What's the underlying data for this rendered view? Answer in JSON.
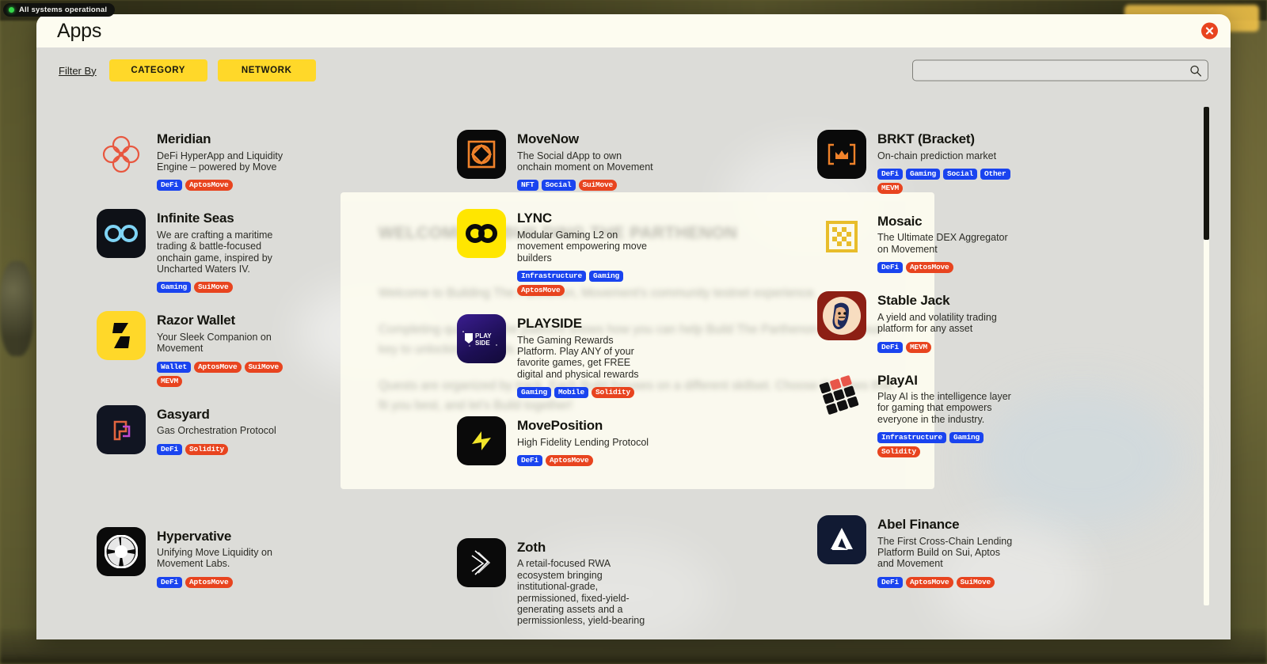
{
  "status": {
    "text": "All systems operational",
    "dot_color": "#35d64a"
  },
  "modal": {
    "title": "Apps",
    "close_label": "close-button"
  },
  "filter": {
    "label": "Filter By",
    "buttons": [
      "CATEGORY",
      "NETWORK"
    ]
  },
  "search": {
    "value": "",
    "placeholder": ""
  },
  "welcome": {
    "heading": "WELCOME TO BUILDING THE PARTHENON",
    "paragraphs": [
      "Welcome to Building The Parthenon, Movement's community testnet experience.",
      "Completing quests on the platform shows how you can help Build The Parthenon and is your key to unlocking rewards.",
      "Quests are organized by track. Each Build focuses on a different skillset. Choose the ones that fit you best, and let's Build together!"
    ]
  },
  "colors": {
    "accent_yellow": "#ffd829",
    "tag_category": "#1a44ef",
    "tag_network": "#e8441f",
    "close_red": "#e8441f",
    "header_cream": "#fdfcf0",
    "body_grey": "#dcdcd8"
  },
  "scrollbar": {
    "thumb_percent": 27
  },
  "columns": [
    {
      "apps": [
        {
          "name": "Meridian",
          "desc": "DeFi HyperApp and Liquidity Engine – powered by Move",
          "icon": "meridian-logo",
          "categories": [
            "DeFi"
          ],
          "networks": [
            "AptosMove"
          ]
        },
        {
          "name": "Infinite Seas",
          "desc": "We are crafting a maritime trading & battle-focused onchain game, inspired by Uncharted Waters IV.",
          "icon": "infinite-seas-logo",
          "categories": [
            "Gaming"
          ],
          "networks": [
            "SuiMove"
          ]
        },
        {
          "name": "Razor Wallet",
          "desc": "Your Sleek Companion on Movement",
          "icon": "razor-wallet-logo",
          "categories": [
            "Wallet"
          ],
          "networks": [
            "AptosMove",
            "SuiMove",
            "MEVM"
          ]
        },
        {
          "name": "Gasyard",
          "desc": "Gas Orchestration Protocol",
          "icon": "gasyard-logo",
          "categories": [
            "DeFi"
          ],
          "networks": [
            "Solidity"
          ]
        },
        {
          "name": "Hypervative",
          "desc": "Unifying Move Liquidity on Movement Labs.",
          "icon": "hypervative-logo",
          "categories": [
            "DeFi"
          ],
          "networks": [
            "AptosMove"
          ]
        }
      ]
    },
    {
      "apps": [
        {
          "name": "MoveNow",
          "desc": "The Social dApp to own onchain moment on Movement",
          "icon": "movenow-logo",
          "categories": [
            "NFT",
            "Social"
          ],
          "networks": [
            "SuiMove"
          ]
        },
        {
          "name": "LYNC",
          "desc": "Modular Gaming L2 on movement empowering move builders",
          "icon": "lync-logo",
          "categories": [
            "Infrastructure",
            "Gaming"
          ],
          "networks": [
            "AptosMove"
          ]
        },
        {
          "name": "PLAYSIDE",
          "desc": "The Gaming Rewards Platform. Play ANY of your favorite games, get FREE digital and physical rewards",
          "icon": "playside-logo",
          "categories": [
            "Gaming",
            "Mobile"
          ],
          "networks": [
            "Solidity"
          ]
        },
        {
          "name": "MovePosition",
          "desc": "High Fidelity Lending Protocol",
          "icon": "moveposition-logo",
          "categories": [
            "DeFi"
          ],
          "networks": [
            "AptosMove"
          ]
        },
        {
          "name": "Zoth",
          "desc": "A retail-focused RWA ecosystem bringing institutional-grade, permissioned, fixed-yield-generating assets and a permissionless, yield-bearing",
          "icon": "zoth-logo",
          "categories": [],
          "networks": []
        }
      ]
    },
    {
      "apps": [
        {
          "name": "BRKT (Bracket)",
          "desc": "On-chain prediction market",
          "icon": "brkt-logo",
          "categories": [
            "DeFi",
            "Gaming",
            "Social",
            "Other"
          ],
          "networks": [
            "MEVM"
          ]
        },
        {
          "name": "Mosaic",
          "desc": "The Ultimate DEX Aggregator on Movement",
          "icon": "mosaic-logo",
          "categories": [
            "DeFi"
          ],
          "networks": [
            "AptosMove"
          ]
        },
        {
          "name": "Stable Jack",
          "desc": "A yield and volatility trading platform for any asset",
          "icon": "stable-jack-logo",
          "categories": [
            "DeFi"
          ],
          "networks": [
            "MEVM"
          ]
        },
        {
          "name": "PlayAI",
          "desc": "Play AI is the intelligence layer for gaming that empowers everyone in the industry.",
          "icon": "playai-logo",
          "categories": [
            "Infrastructure",
            "Gaming"
          ],
          "networks": [
            "Solidity"
          ]
        },
        {
          "name": "Abel Finance",
          "desc": "The First Cross-Chain Lending Platform Build on Sui, Aptos and Movement",
          "icon": "abel-finance-logo",
          "categories": [
            "DeFi"
          ],
          "networks": [
            "AptosMove",
            "SuiMove"
          ]
        }
      ]
    }
  ]
}
